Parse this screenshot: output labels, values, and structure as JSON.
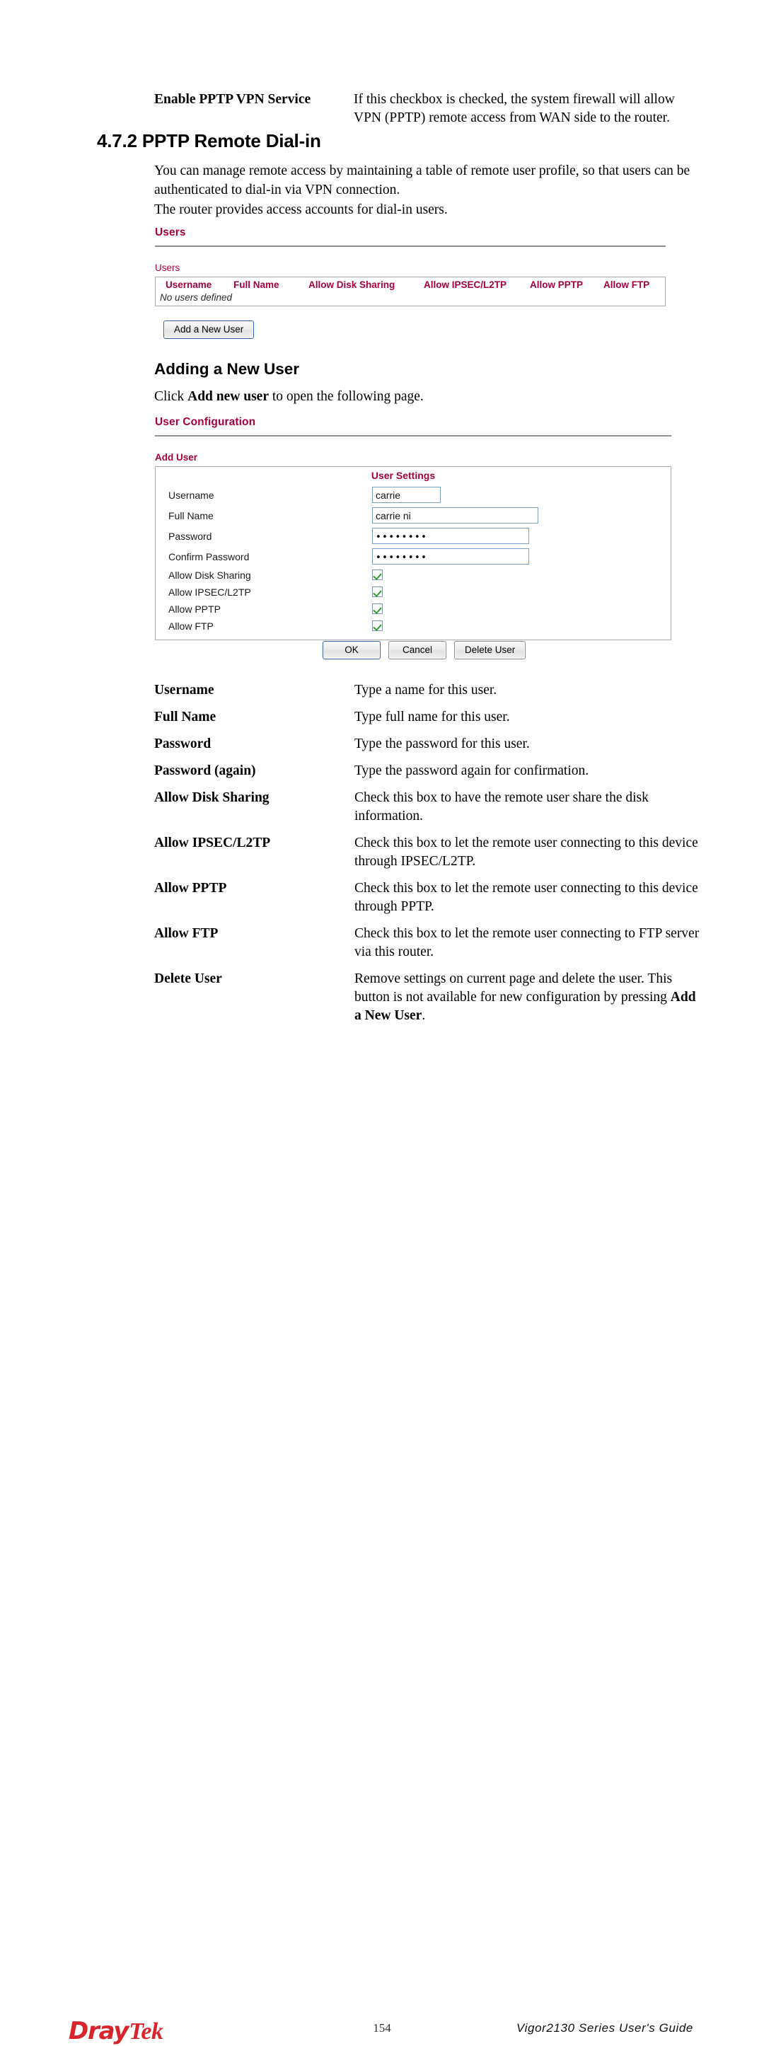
{
  "top_definition": {
    "term": "Enable PPTP VPN Service",
    "description": "If this checkbox is checked, the system firewall will allow VPN (PPTP) remote access from WAN side to the router."
  },
  "section": {
    "heading": "4.7.2 PPTP Remote Dial-in",
    "paragraph_1": "You can manage remote access by maintaining a table of remote user profile, so that users can be authenticated to dial-in via VPN connection.",
    "paragraph_2": "The router provides access accounts for dial-in users."
  },
  "users_screenshot": {
    "panel_title": "Users",
    "table_label": "Users",
    "columns": [
      "Username",
      "Full Name",
      "Allow Disk Sharing",
      "Allow IPSEC/L2TP",
      "Allow PPTP",
      "Allow FTP"
    ],
    "empty_message": "No users defined",
    "add_button": "Add a New User"
  },
  "subsection": {
    "heading": "Adding a New User",
    "instruction_prefix": "Click ",
    "instruction_bold": "Add new user",
    "instruction_suffix": " to open the following page."
  },
  "user_config_screenshot": {
    "panel_title": "User Configuration",
    "table_label": "Add User",
    "settings_header": "User Settings",
    "fields": [
      {
        "label": "Username",
        "value": "carrie",
        "type": "text"
      },
      {
        "label": "Full Name",
        "value": "carrie ni",
        "type": "text"
      },
      {
        "label": "Password",
        "value": "••••••••",
        "type": "password"
      },
      {
        "label": "Confirm Password",
        "value": "••••••••",
        "type": "password"
      },
      {
        "label": "Allow Disk Sharing",
        "checked": true,
        "type": "checkbox"
      },
      {
        "label": "Allow IPSEC/L2TP",
        "checked": true,
        "type": "checkbox"
      },
      {
        "label": "Allow PPTP",
        "checked": true,
        "type": "checkbox"
      },
      {
        "label": "Allow FTP",
        "checked": true,
        "type": "checkbox"
      }
    ],
    "buttons": {
      "ok": "OK",
      "cancel": "Cancel",
      "delete": "Delete User"
    },
    "accent_color": "#A8003E"
  },
  "definitions": [
    {
      "term": "Username",
      "description": "Type a name for this user."
    },
    {
      "term": "Full Name",
      "description": "Type full name for this user."
    },
    {
      "term": "Password",
      "description": "Type the password for this user."
    },
    {
      "term": "Password (again)",
      "description": "Type the password again for confirmation."
    },
    {
      "term": "Allow Disk Sharing",
      "description": "Check this box to have the remote user share the disk information."
    },
    {
      "term": "Allow IPSEC/L2TP",
      "description": "Check this box to let the remote user connecting to this device through IPSEC/L2TP."
    },
    {
      "term": "Allow PPTP",
      "description": "Check this box to let the remote user connecting to this device through PPTP."
    },
    {
      "term": "Allow FTP",
      "description": "Check this box to let the remote user connecting to FTP server via this router."
    },
    {
      "term": "Delete User",
      "description_part1": "Remove settings on current page and delete the user. This button is not available for new configuration by pressing ",
      "description_bold": "Add a New User",
      "description_part2": "."
    }
  ],
  "footer": {
    "logo_part1": "Dray",
    "logo_part2": "Tek",
    "page_number": "154",
    "guide_title": "Vigor2130 Series User's Guide",
    "logo_color": "#D8242B"
  }
}
